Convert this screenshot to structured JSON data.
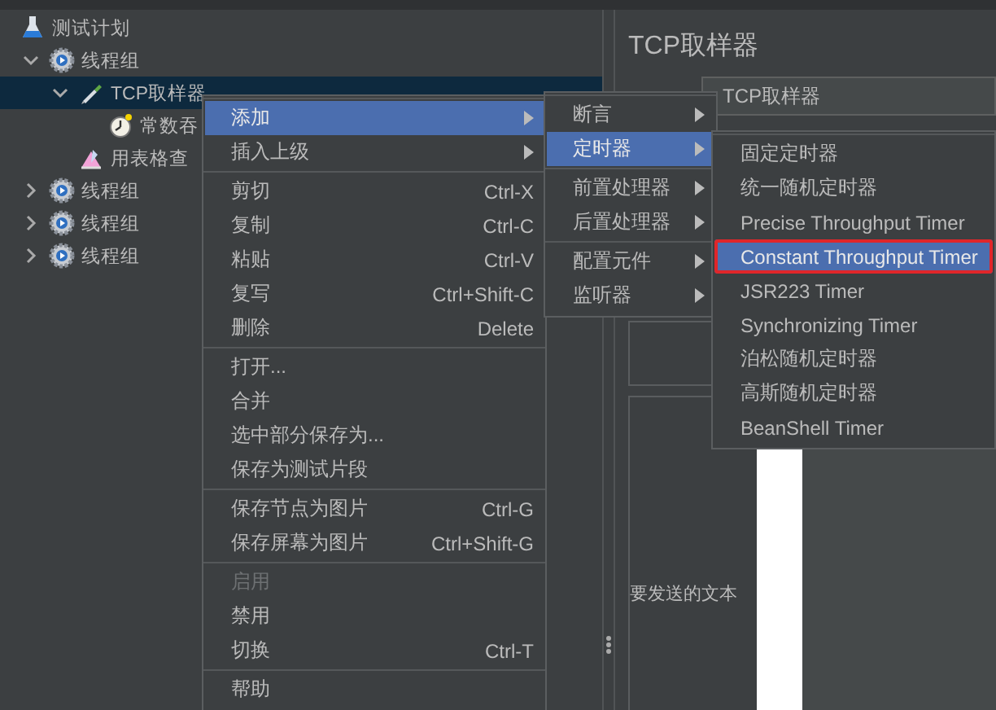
{
  "tree": [
    {
      "label": "测试计划",
      "kind": "plan",
      "selected": false,
      "children": [
        {
          "label": "线程组",
          "kind": "thread-group",
          "expanded": true,
          "selected": false,
          "children": [
            {
              "label": "TCP取样器",
              "kind": "sampler",
              "expanded": true,
              "selected": true,
              "children": [
                {
                  "label": "常数吞",
                  "kind": "timer",
                  "selected": false
                }
              ]
            },
            {
              "label": "用表格查",
              "kind": "listener",
              "selected": false
            }
          ]
        },
        {
          "label": "线程组",
          "kind": "thread-group",
          "expanded": false,
          "selected": false
        },
        {
          "label": "线程组",
          "kind": "thread-group",
          "expanded": false,
          "selected": false
        },
        {
          "label": "线程组",
          "kind": "thread-group",
          "expanded": false,
          "selected": false
        }
      ]
    }
  ],
  "editor": {
    "title": "TCP取样器",
    "name_value": "TCP取样器",
    "text_label": "要发送的文本"
  },
  "context_menu": {
    "sections": [
      {
        "items": [
          {
            "label": "添加",
            "submenu": true,
            "selected": true,
            "disabled": false
          },
          {
            "label": "插入上级",
            "submenu": true,
            "selected": false,
            "disabled": false
          }
        ]
      },
      {
        "items": [
          {
            "label": "剪切",
            "shortcut": "Ctrl-X",
            "submenu": false,
            "selected": false,
            "disabled": false
          },
          {
            "label": "复制",
            "shortcut": "Ctrl-C",
            "submenu": false,
            "selected": false,
            "disabled": false
          },
          {
            "label": "粘贴",
            "shortcut": "Ctrl-V",
            "submenu": false,
            "selected": false,
            "disabled": false
          },
          {
            "label": "复写",
            "shortcut": "Ctrl+Shift-C",
            "submenu": false,
            "selected": false,
            "disabled": false
          },
          {
            "label": "删除",
            "shortcut": "Delete",
            "submenu": false,
            "selected": false,
            "disabled": false
          }
        ]
      },
      {
        "items": [
          {
            "label": "打开...",
            "submenu": false,
            "selected": false,
            "disabled": false
          },
          {
            "label": "合并",
            "submenu": false,
            "selected": false,
            "disabled": false
          },
          {
            "label": "选中部分保存为...",
            "submenu": false,
            "selected": false,
            "disabled": false
          },
          {
            "label": "保存为测试片段",
            "submenu": false,
            "selected": false,
            "disabled": false
          }
        ]
      },
      {
        "items": [
          {
            "label": "保存节点为图片",
            "shortcut": "Ctrl-G",
            "submenu": false,
            "selected": false,
            "disabled": false
          },
          {
            "label": "保存屏幕为图片",
            "shortcut": "Ctrl+Shift-G",
            "submenu": false,
            "selected": false,
            "disabled": false
          }
        ]
      },
      {
        "items": [
          {
            "label": "启用",
            "submenu": false,
            "selected": false,
            "disabled": true
          },
          {
            "label": "禁用",
            "submenu": false,
            "selected": false,
            "disabled": false
          },
          {
            "label": "切换",
            "shortcut": "Ctrl-T",
            "submenu": false,
            "selected": false,
            "disabled": false
          }
        ]
      },
      {
        "items": [
          {
            "label": "帮助",
            "submenu": false,
            "selected": false,
            "disabled": false
          }
        ]
      }
    ]
  },
  "add_submenu": {
    "sections": [
      {
        "items": [
          {
            "label": "断言",
            "submenu": true,
            "selected": false
          },
          {
            "label": "定时器",
            "submenu": true,
            "selected": true
          }
        ]
      },
      {
        "items": [
          {
            "label": "前置处理器",
            "submenu": true,
            "selected": false
          },
          {
            "label": "后置处理器",
            "submenu": true,
            "selected": false
          }
        ]
      },
      {
        "items": [
          {
            "label": "配置元件",
            "submenu": true,
            "selected": false
          },
          {
            "label": "监听器",
            "submenu": true,
            "selected": false
          }
        ]
      }
    ]
  },
  "timer_submenu": {
    "sections": [
      {
        "items": [
          {
            "label": "固定定时器",
            "selected": false,
            "outlined": false
          },
          {
            "label": "统一随机定时器",
            "selected": false,
            "outlined": false
          },
          {
            "label": "Precise Throughput Timer",
            "selected": false,
            "outlined": false
          },
          {
            "label": "Constant Throughput Timer",
            "selected": true,
            "outlined": true
          },
          {
            "label": "JSR223 Timer",
            "selected": false,
            "outlined": false
          },
          {
            "label": "Synchronizing Timer",
            "selected": false,
            "outlined": false
          },
          {
            "label": "泊松随机定时器",
            "selected": false,
            "outlined": false
          },
          {
            "label": "高斯随机定时器",
            "selected": false,
            "outlined": false
          },
          {
            "label": "BeanShell Timer",
            "selected": false,
            "outlined": false
          }
        ]
      }
    ]
  }
}
